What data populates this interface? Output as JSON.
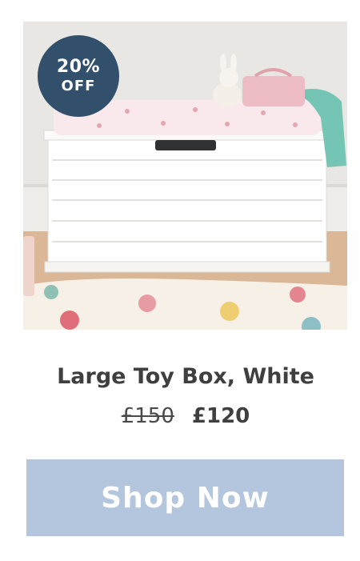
{
  "product": {
    "image_alt": "Large Toy Box, White",
    "badge": {
      "percent": "20%",
      "label": "OFF"
    },
    "title": "Large Toy Box, White",
    "price_was": "£150",
    "price_now": "£120"
  },
  "cta": {
    "label": "Shop Now"
  },
  "colors": {
    "badge": "#324f6b",
    "button": "#b4c6dd",
    "text": "#3f3f3f"
  }
}
